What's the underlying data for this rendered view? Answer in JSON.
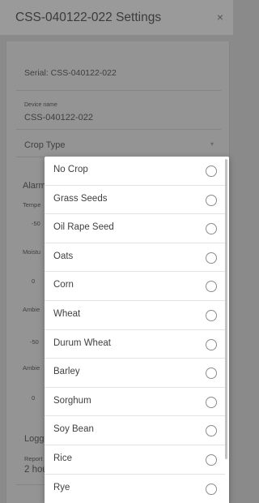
{
  "dialog": {
    "title": "CSS-040122-022 Settings",
    "close_label": "×"
  },
  "settings": {
    "serial_text": "Serial: CSS-040122-022",
    "device_name_label": "Device name",
    "device_name_value": "CSS-040122-022",
    "crop_type_label": "Crop Type",
    "crop_type_arrow": "▾",
    "alarms_label": "Alarm",
    "temp_label": "Tempe",
    "temp_value": "-50",
    "moisture_label": "Moistu",
    "moisture_value": "0",
    "ambient1_label": "Ambie",
    "ambient1_value": "-50",
    "ambient2_label": "Ambie",
    "ambient2_value": "0",
    "logging_label": "Loggi",
    "report_label": "Report",
    "report_value": "2 hou"
  },
  "crop_options": [
    {
      "label": "No Crop",
      "selected": false
    },
    {
      "label": "Grass Seeds",
      "selected": false
    },
    {
      "label": "Oil Rape Seed",
      "selected": false
    },
    {
      "label": "Oats",
      "selected": false
    },
    {
      "label": "Corn",
      "selected": false
    },
    {
      "label": "Wheat",
      "selected": false
    },
    {
      "label": "Durum Wheat",
      "selected": false
    },
    {
      "label": "Barley",
      "selected": false
    },
    {
      "label": "Sorghum",
      "selected": false
    },
    {
      "label": "Soy Bean",
      "selected": false
    },
    {
      "label": "Rice",
      "selected": false
    },
    {
      "label": "Rye",
      "selected": false
    }
  ]
}
